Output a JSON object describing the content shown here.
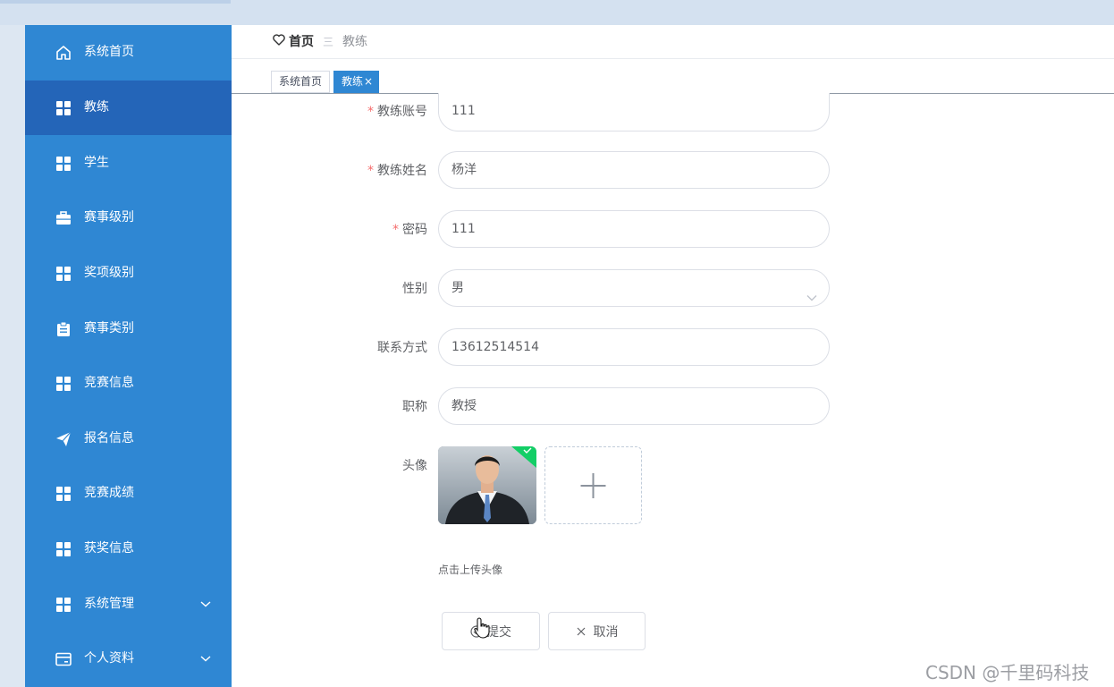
{
  "breadcrumb": {
    "home": "首页",
    "separator": "三",
    "current": "教练"
  },
  "tabs": [
    {
      "label": "系统首页",
      "active": false
    },
    {
      "label": "教练",
      "active": true,
      "close": "×"
    }
  ],
  "sidebar": {
    "items": [
      {
        "label": "系统首页",
        "icon": "home-icon"
      },
      {
        "label": "教练",
        "icon": "grid-icon",
        "active": true
      },
      {
        "label": "学生",
        "icon": "grid-icon"
      },
      {
        "label": "赛事级别",
        "icon": "briefcase-icon"
      },
      {
        "label": "奖项级别",
        "icon": "grid-icon"
      },
      {
        "label": "赛事类别",
        "icon": "clipboard-icon"
      },
      {
        "label": "竞赛信息",
        "icon": "grid-icon"
      },
      {
        "label": "报名信息",
        "icon": "send-icon"
      },
      {
        "label": "竞赛成绩",
        "icon": "grid-icon"
      },
      {
        "label": "获奖信息",
        "icon": "grid-icon"
      },
      {
        "label": "系统管理",
        "icon": "grid-icon",
        "has_submenu": true
      },
      {
        "label": "个人资料",
        "icon": "card-icon",
        "has_submenu": true
      }
    ]
  },
  "form": {
    "account": {
      "label": "教练账号",
      "required": "*",
      "value": "111"
    },
    "name": {
      "label": "教练姓名",
      "required": "*",
      "value": "杨洋"
    },
    "password": {
      "label": "密码",
      "required": "*",
      "value": "111"
    },
    "gender": {
      "label": "性别",
      "value": "男"
    },
    "phone": {
      "label": "联系方式",
      "value": "13612514514"
    },
    "title": {
      "label": "职称",
      "value": "教授"
    },
    "avatar": {
      "label": "头像",
      "tip": "点击上传头像"
    }
  },
  "buttons": {
    "submit": "提交",
    "cancel": "取消"
  },
  "watermark": "CSDN @千里码科技",
  "colors": {
    "sidebar": "#2f87d3",
    "sidebar_active": "#2465b8",
    "required": "#f56c6c",
    "upload_success": "#13ce66"
  }
}
